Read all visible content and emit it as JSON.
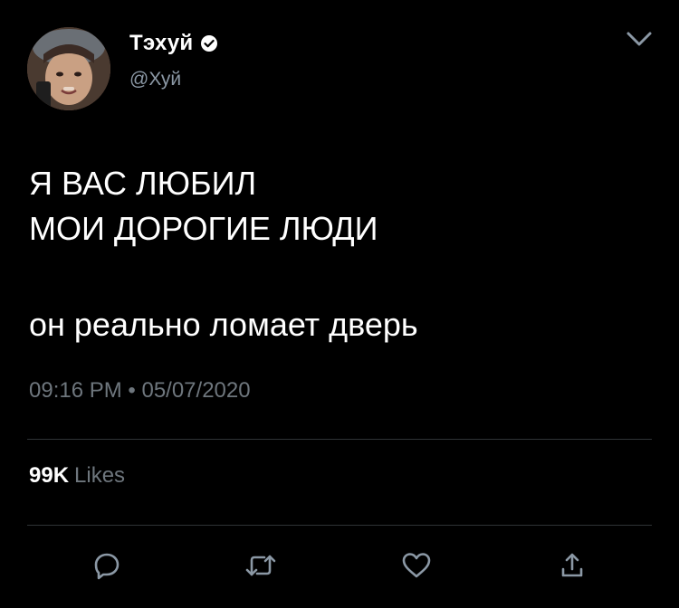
{
  "user": {
    "display_name": "Тэхуй",
    "handle": "@Хуй",
    "verified": true,
    "avatar_icon": "user-avatar"
  },
  "tweet": {
    "lines": [
      "Я ВАС ЛЮБИЛ",
      "МОИ ДОРОГИЕ ЛЮДИ"
    ],
    "reply_text": "он реально ломает дверь",
    "timestamp": "09:16 PM • 05/07/2020"
  },
  "stats": {
    "likes_count": "99K",
    "likes_label": "Likes"
  },
  "actions": {
    "reply_icon": "reply-icon",
    "retweet_icon": "retweet-icon",
    "like_icon": "heart-icon",
    "share_icon": "share-icon",
    "menu_icon": "chevron-down-icon"
  },
  "colors": {
    "background": "#000000",
    "text": "#ffffff",
    "secondary": "#6e767d",
    "divider": "#2f3336",
    "icon": "#8b98a5"
  }
}
